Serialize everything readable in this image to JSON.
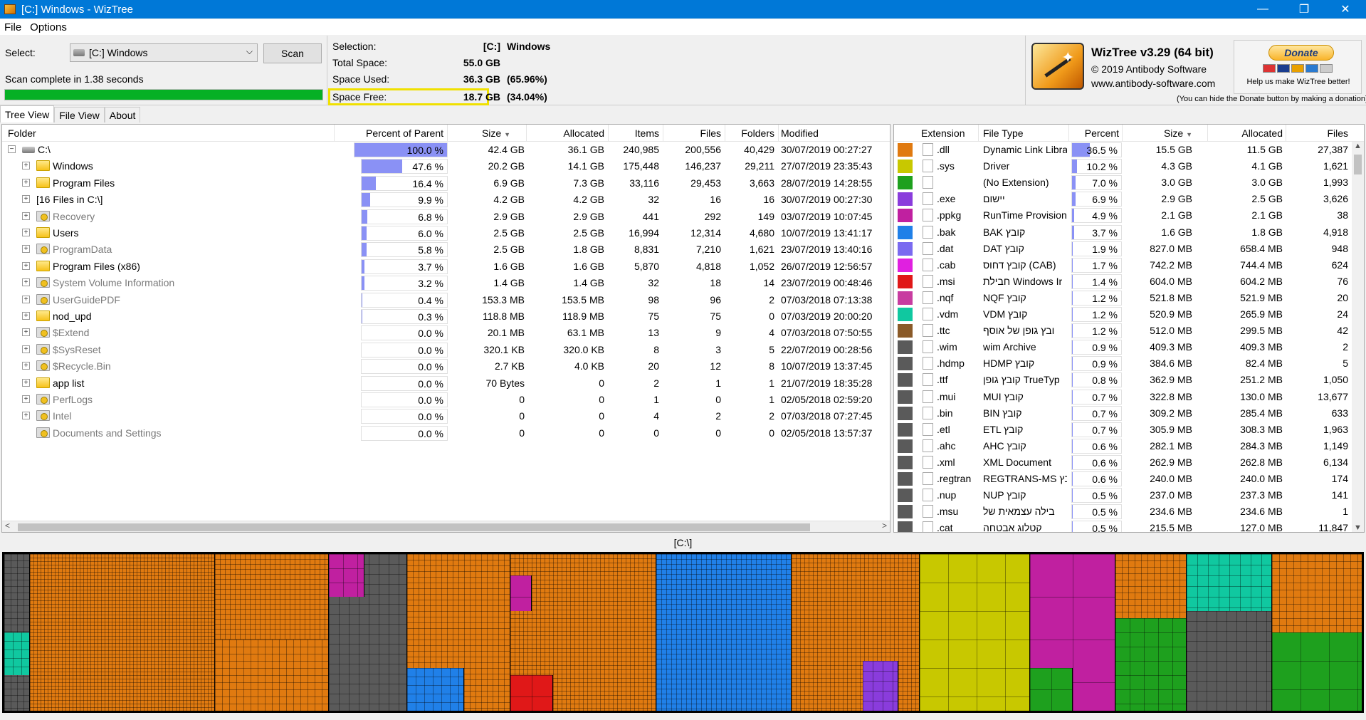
{
  "window": {
    "title": "[C:] Windows  - WizTree"
  },
  "menu": [
    "File",
    "Options"
  ],
  "controls": {
    "select_label": "Select:",
    "drive": "[C:] Windows",
    "scan_label": "Scan",
    "status": "Scan complete in 1.38 seconds",
    "progress": 1.0
  },
  "disk": {
    "selection_label": "Selection:",
    "selection_drive": "[C:]",
    "selection_name": "Windows",
    "total_label": "Total Space:",
    "total": "55.0 GB",
    "used_label": "Space Used:",
    "used": "36.3 GB",
    "used_pct": "(65.96%)",
    "free_label": "Space Free:",
    "free": "18.7 GB",
    "free_pct": "(34.04%)"
  },
  "brand": {
    "title": "WizTree v3.29 (64 bit)",
    "copyright": "© 2019 Antibody Software",
    "url": "www.antibody-software.com",
    "donate": "Donate",
    "help": "Help us make WizTree better!",
    "note": "(You can hide the Donate button by making a donation)"
  },
  "tabs": [
    "Tree View",
    "File View",
    "About"
  ],
  "tree": {
    "headers": {
      "folder": "Folder",
      "pct": "Percent of Parent",
      "size": "Size",
      "alloc": "Allocated",
      "items": "Items",
      "files": "Files",
      "folders": "Folders",
      "modified": "Modified"
    },
    "rows": [
      {
        "name": "C:\\",
        "pct": "100.0 %",
        "pv": 1.0,
        "size": "42.4 GB",
        "alloc": "36.1 GB",
        "items": "240,985",
        "files": "200,556",
        "folders": "40,429",
        "mod": "30/07/2019 00:27:27",
        "icon": "drive-icon"
      },
      {
        "name": "Windows",
        "pct": "47.6 %",
        "pv": 0.476,
        "size": "20.2 GB",
        "alloc": "14.1 GB",
        "items": "175,448",
        "files": "146,237",
        "folders": "29,211",
        "mod": "27/07/2019 23:35:43",
        "icon": "folder-icon"
      },
      {
        "name": "Program Files",
        "pct": "16.4 %",
        "pv": 0.164,
        "size": "6.9 GB",
        "alloc": "7.3 GB",
        "items": "33,116",
        "files": "29,453",
        "folders": "3,663",
        "mod": "28/07/2019 14:28:55",
        "icon": "folder-icon"
      },
      {
        "name": "[16 Files in C:\\]",
        "pct": "9.9 %",
        "pv": 0.099,
        "size": "4.2 GB",
        "alloc": "4.2 GB",
        "items": "32",
        "files": "16",
        "folders": "16",
        "mod": "30/07/2019 00:27:30",
        "icon": "none"
      },
      {
        "name": "Recovery",
        "pct": "6.8 %",
        "pv": 0.068,
        "size": "2.9 GB",
        "alloc": "2.9 GB",
        "items": "441",
        "files": "292",
        "folders": "149",
        "mod": "03/07/2019 10:07:45",
        "icon": "system-folder-icon",
        "gray": true
      },
      {
        "name": "Users",
        "pct": "6.0 %",
        "pv": 0.06,
        "size": "2.5 GB",
        "alloc": "2.5 GB",
        "items": "16,994",
        "files": "12,314",
        "folders": "4,680",
        "mod": "10/07/2019 13:41:17",
        "icon": "folder-icon"
      },
      {
        "name": "ProgramData",
        "pct": "5.8 %",
        "pv": 0.058,
        "size": "2.5 GB",
        "alloc": "1.8 GB",
        "items": "8,831",
        "files": "7,210",
        "folders": "1,621",
        "mod": "23/07/2019 13:40:16",
        "icon": "system-folder-icon",
        "gray": true
      },
      {
        "name": "Program Files (x86)",
        "pct": "3.7 %",
        "pv": 0.037,
        "size": "1.6 GB",
        "alloc": "1.6 GB",
        "items": "5,870",
        "files": "4,818",
        "folders": "1,052",
        "mod": "26/07/2019 12:56:57",
        "icon": "folder-icon"
      },
      {
        "name": "System Volume Information",
        "pct": "3.2 %",
        "pv": 0.032,
        "size": "1.4 GB",
        "alloc": "1.4 GB",
        "items": "32",
        "files": "18",
        "folders": "14",
        "mod": "23/07/2019 00:48:46",
        "icon": "system-folder-icon",
        "gray": true
      },
      {
        "name": "UserGuidePDF",
        "pct": "0.4 %",
        "pv": 0.004,
        "size": "153.3 MB",
        "alloc": "153.5 MB",
        "items": "98",
        "files": "96",
        "folders": "2",
        "mod": "07/03/2018 07:13:38",
        "icon": "system-folder-icon",
        "gray": true
      },
      {
        "name": "nod_upd",
        "pct": "0.3 %",
        "pv": 0.003,
        "size": "118.8 MB",
        "alloc": "118.9 MB",
        "items": "75",
        "files": "75",
        "folders": "0",
        "mod": "07/03/2019 20:00:20",
        "icon": "folder-icon"
      },
      {
        "name": "$Extend",
        "pct": "0.0 %",
        "pv": 0,
        "size": "20.1 MB",
        "alloc": "63.1 MB",
        "items": "13",
        "files": "9",
        "folders": "4",
        "mod": "07/03/2018 07:50:55",
        "icon": "system-folder-icon",
        "gray": true
      },
      {
        "name": "$SysReset",
        "pct": "0.0 %",
        "pv": 0,
        "size": "320.1 KB",
        "alloc": "320.0 KB",
        "items": "8",
        "files": "3",
        "folders": "5",
        "mod": "22/07/2019 00:28:56",
        "icon": "system-folder-icon",
        "gray": true
      },
      {
        "name": "$Recycle.Bin",
        "pct": "0.0 %",
        "pv": 0,
        "size": "2.7 KB",
        "alloc": "4.0 KB",
        "items": "20",
        "files": "12",
        "folders": "8",
        "mod": "10/07/2019 13:37:45",
        "icon": "system-folder-icon",
        "gray": true
      },
      {
        "name": "app list",
        "pct": "0.0 %",
        "pv": 0,
        "size": "70 Bytes",
        "alloc": "0",
        "items": "2",
        "files": "1",
        "folders": "1",
        "mod": "21/07/2019 18:35:28",
        "icon": "folder-icon"
      },
      {
        "name": "PerfLogs",
        "pct": "0.0 %",
        "pv": 0,
        "size": "0",
        "alloc": "0",
        "items": "1",
        "files": "0",
        "folders": "1",
        "mod": "02/05/2018 02:59:20",
        "icon": "system-folder-icon",
        "gray": true
      },
      {
        "name": "Intel",
        "pct": "0.0 %",
        "pv": 0,
        "size": "0",
        "alloc": "0",
        "items": "4",
        "files": "2",
        "folders": "2",
        "mod": "07/03/2018 07:27:45",
        "icon": "system-folder-icon",
        "gray": true
      },
      {
        "name": "Documents and Settings",
        "pct": "0.0 %",
        "pv": 0,
        "size": "0",
        "alloc": "0",
        "items": "0",
        "files": "0",
        "folders": "0",
        "mod": "02/05/2018 13:57:37",
        "icon": "system-folder-icon",
        "gray": true
      }
    ]
  },
  "ext": {
    "headers": {
      "ext": "Extension",
      "type": "File Type",
      "pct": "Percent",
      "size": "Size",
      "alloc": "Allocated",
      "files": "Files"
    },
    "rows": [
      {
        "ext": ".dll",
        "type": "Dynamic Link Libra",
        "pct": "36.5 %",
        "pv": 0.365,
        "size": "15.5 GB",
        "alloc": "11.5 GB",
        "files": "27,387",
        "color": "#e07a10"
      },
      {
        "ext": ".sys",
        "type": "Driver",
        "pct": "10.2 %",
        "pv": 0.102,
        "size": "4.3 GB",
        "alloc": "4.1 GB",
        "files": "1,621",
        "color": "#c8c800"
      },
      {
        "ext": "",
        "type": "(No Extension)",
        "pct": "7.0 %",
        "pv": 0.07,
        "size": "3.0 GB",
        "alloc": "3.0 GB",
        "files": "1,993",
        "color": "#1ea01e"
      },
      {
        "ext": ".exe",
        "type": "יישום",
        "pct": "6.9 %",
        "pv": 0.069,
        "size": "2.9 GB",
        "alloc": "2.5 GB",
        "files": "3,626",
        "color": "#8a3cdc"
      },
      {
        "ext": ".ppkg",
        "type": "RunTime Provision",
        "pct": "4.9 %",
        "pv": 0.049,
        "size": "2.1 GB",
        "alloc": "2.1 GB",
        "files": "38",
        "color": "#c020a0"
      },
      {
        "ext": ".bak",
        "type": "BAK קובץ",
        "pct": "3.7 %",
        "pv": 0.037,
        "size": "1.6 GB",
        "alloc": "1.8 GB",
        "files": "4,918",
        "color": "#2080e8"
      },
      {
        "ext": ".dat",
        "type": "DAT קובץ",
        "pct": "1.9 %",
        "pv": 0.019,
        "size": "827.0 MB",
        "alloc": "658.4 MB",
        "files": "948",
        "color": "#7a6af0"
      },
      {
        "ext": ".cab",
        "type": "קובץ דחוס (CAB)",
        "pct": "1.7 %",
        "pv": 0.017,
        "size": "742.2 MB",
        "alloc": "744.4 MB",
        "files": "624",
        "color": "#e020e0"
      },
      {
        "ext": ".msi",
        "type": "חבילת Windows Ir",
        "pct": "1.4 %",
        "pv": 0.014,
        "size": "604.0 MB",
        "alloc": "604.2 MB",
        "files": "76",
        "color": "#e01818"
      },
      {
        "ext": ".nqf",
        "type": "NQF קובץ",
        "pct": "1.2 %",
        "pv": 0.012,
        "size": "521.8 MB",
        "alloc": "521.9 MB",
        "files": "20",
        "color": "#c83ca0"
      },
      {
        "ext": ".vdm",
        "type": "VDM קובץ",
        "pct": "1.2 %",
        "pv": 0.012,
        "size": "520.9 MB",
        "alloc": "265.9 MB",
        "files": "24",
        "color": "#10c8a0"
      },
      {
        "ext": ".ttc",
        "type": "ובץ גופן של אוסף",
        "pct": "1.2 %",
        "pv": 0.012,
        "size": "512.0 MB",
        "alloc": "299.5 MB",
        "files": "42",
        "color": "#8a5a28"
      },
      {
        "ext": ".wim",
        "type": "wim Archive",
        "pct": "0.9 %",
        "pv": 0.009,
        "size": "409.3 MB",
        "alloc": "409.3 MB",
        "files": "2",
        "color": "#5a5a5a"
      },
      {
        "ext": ".hdmp",
        "type": "HDMP קובץ",
        "pct": "0.9 %",
        "pv": 0.009,
        "size": "384.6 MB",
        "alloc": "82.4 MB",
        "files": "5",
        "color": "#5a5a5a"
      },
      {
        "ext": ".ttf",
        "type": "קובץ גופן TrueTyp",
        "pct": "0.8 %",
        "pv": 0.008,
        "size": "362.9 MB",
        "alloc": "251.2 MB",
        "files": "1,050",
        "color": "#5a5a5a"
      },
      {
        "ext": ".mui",
        "type": "MUI קובץ",
        "pct": "0.7 %",
        "pv": 0.007,
        "size": "322.8 MB",
        "alloc": "130.0 MB",
        "files": "13,677",
        "color": "#5a5a5a"
      },
      {
        "ext": ".bin",
        "type": "BIN קובץ",
        "pct": "0.7 %",
        "pv": 0.007,
        "size": "309.2 MB",
        "alloc": "285.4 MB",
        "files": "633",
        "color": "#5a5a5a"
      },
      {
        "ext": ".etl",
        "type": "ETL קובץ",
        "pct": "0.7 %",
        "pv": 0.007,
        "size": "305.9 MB",
        "alloc": "308.3 MB",
        "files": "1,963",
        "color": "#5a5a5a"
      },
      {
        "ext": ".ahc",
        "type": "AHC קובץ",
        "pct": "0.6 %",
        "pv": 0.006,
        "size": "282.1 MB",
        "alloc": "284.3 MB",
        "files": "1,149",
        "color": "#5a5a5a"
      },
      {
        "ext": ".xml",
        "type": "XML Document",
        "pct": "0.6 %",
        "pv": 0.006,
        "size": "262.9 MB",
        "alloc": "262.8 MB",
        "files": "6,134",
        "color": "#5a5a5a"
      },
      {
        "ext": ".regtran",
        "type": "REGTRANS-MS קובץ",
        "pct": "0.6 %",
        "pv": 0.006,
        "size": "240.0 MB",
        "alloc": "240.0 MB",
        "files": "174",
        "color": "#5a5a5a"
      },
      {
        "ext": ".nup",
        "type": "NUP קובץ",
        "pct": "0.5 %",
        "pv": 0.005,
        "size": "237.0 MB",
        "alloc": "237.3 MB",
        "files": "141",
        "color": "#5a5a5a"
      },
      {
        "ext": ".msu",
        "type": "בילה עצמאית של",
        "pct": "0.5 %",
        "pv": 0.005,
        "size": "234.6 MB",
        "alloc": "234.6 MB",
        "files": "1",
        "color": "#5a5a5a"
      },
      {
        "ext": ".cat",
        "type": "קטלוג אבטחה",
        "pct": "0.5 %",
        "pv": 0.005,
        "size": "215.5 MB",
        "alloc": "127.0 MB",
        "files": "11,847",
        "color": "#5a5a5a"
      }
    ]
  },
  "treemap": {
    "caption": "[C:\\]",
    "colors": {
      "dll": "#e07a10",
      "sys": "#c8c800",
      "noext": "#1ea01e",
      "exe": "#8a3cdc",
      "ppkg": "#c020a0",
      "bak": "#2080e8",
      "msi": "#e01818",
      "vdm": "#10c8a0",
      "other": "#5a5a5a"
    }
  }
}
